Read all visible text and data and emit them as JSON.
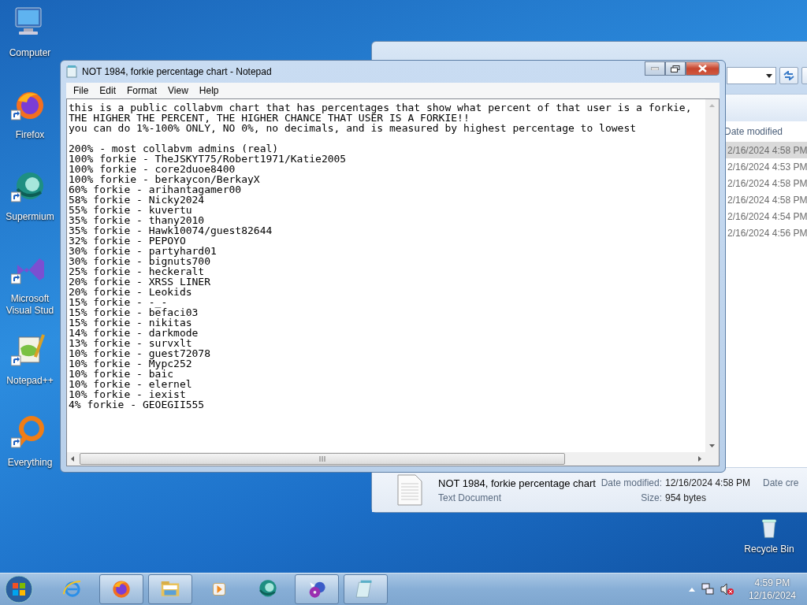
{
  "desktop_icons": [
    {
      "label": "Computer",
      "kind": "computer"
    },
    {
      "label": "Firefox",
      "kind": "firefox"
    },
    {
      "label": "Supermium",
      "kind": "supermium"
    },
    {
      "label": "Microsoft Visual Stud",
      "kind": "visualstudio"
    },
    {
      "label": "Notepad++",
      "kind": "notepadpp"
    },
    {
      "label": "Everything",
      "kind": "everything"
    }
  ],
  "recycle_bin": {
    "label": "Recycle Bin"
  },
  "explorer": {
    "column_header": "Date modified",
    "rows": [
      {
        "date": "2/16/2024 4:58 PM",
        "selected": true
      },
      {
        "date": "2/16/2024 4:53 PM",
        "selected": false
      },
      {
        "date": "2/16/2024 4:58 PM",
        "selected": false
      },
      {
        "date": "2/16/2024 4:58 PM",
        "selected": false
      },
      {
        "date": "2/16/2024 4:54 PM",
        "selected": false
      },
      {
        "date": "2/16/2024 4:56 PM",
        "selected": false
      }
    ],
    "details": {
      "name": "NOT 1984, forkie percentage chart",
      "type": "Text Document",
      "date_label": "Date modified:",
      "date": "12/16/2024 4:58 PM",
      "size_label": "Size:",
      "size": "954 bytes",
      "column_3": "Date cre"
    }
  },
  "notepad": {
    "title": "NOT 1984, forkie percentage chart - Notepad",
    "menu": [
      "File",
      "Edit",
      "Format",
      "View",
      "Help"
    ],
    "intro_lines": [
      "this is a public collabvm chart that has percentages that show what percent of that user is a forkie,",
      "THE HIGHER THE PERCENT, THE HIGHER CHANCE THAT USER IS A FORKIE!!",
      "you can do 1%-100% ONLY, NO 0%, no decimals, and is measured by highest percentage to lowest"
    ],
    "chart_lines": [
      "200% - most collabvm admins (real)",
      "100% forkie - TheJSKYT75/Robert1971/Katie2005",
      "100% forkie - core2duoe8400",
      "100% forkie - berkaycon/BerkayX",
      "60% forkie - arihantagamer00",
      "58% forkie - Nicky2024",
      "55% forkie - kuvertu",
      "35% forkie - thany2010",
      "35% forkie - Hawk10074/guest82644",
      "32% forkie - PEPOYO",
      "30% forkie - partyhard01",
      "30% forkie - bignuts700",
      "25% forkie - heckeralt",
      "20% forkie - XRSS LINER",
      "20% forkie - Leokids",
      "15% forkie - -_-",
      "15% forkie - befaci03",
      "15% forkie - nikitas",
      "14% forkie - darkmode",
      "13% forkie - survxlt",
      "10% forkie - guest72078",
      "10% forkie - Mypc252",
      "10% forkie - baic",
      "10% forkie - elernel",
      "10% forkie - iexist",
      "4% forkie - GEOEGII555"
    ]
  },
  "taskbar": {
    "items": [
      {
        "kind": "ie",
        "running": false
      },
      {
        "kind": "firefox",
        "running": true
      },
      {
        "kind": "folder",
        "running": true
      },
      {
        "kind": "media",
        "running": false
      },
      {
        "kind": "supermium",
        "running": false
      },
      {
        "kind": "disc",
        "running": true
      },
      {
        "kind": "notepad",
        "running": true
      }
    ],
    "clock": {
      "time": "4:59 PM",
      "date": "12/16/2024"
    }
  }
}
